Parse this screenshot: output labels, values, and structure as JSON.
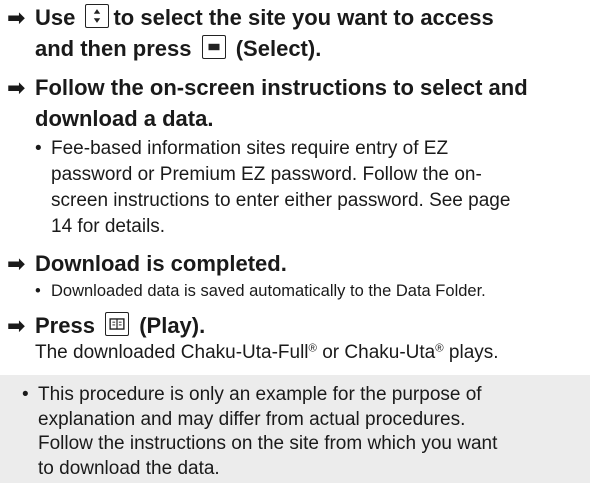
{
  "steps": [
    {
      "arrow": "➡",
      "line1_before": "Use",
      "key1_icon": "up-down-navigation-key-icon",
      "line1_after": "to select the site you want to access",
      "line2_before": "and then press",
      "key2_icon": "center-select-key-icon",
      "line2_after": "(Select)."
    },
    {
      "arrow": "➡",
      "line1": "Follow the on-screen instructions to select and",
      "line2": "download a data.",
      "bullets": [
        {
          "lines": [
            "Fee-based information sites require entry of EZ",
            "password or Premium EZ password. Follow the on-",
            "screen instructions to enter either password. See page",
            "14 for details."
          ]
        }
      ]
    },
    {
      "arrow": "➡",
      "line1": "Download is completed.",
      "bullets": [
        {
          "text": "Downloaded data is saved automatically to the Data Folder."
        }
      ]
    },
    {
      "arrow": "➡",
      "line1_before": "Press",
      "key_icon": "book-play-key-icon",
      "line1_after": "(Play).",
      "body_part1": "The downloaded Chaku-Uta-Full",
      "reg1": "®",
      "body_part2": " or Chaku-Uta",
      "reg2": "®",
      "body_part3": " plays."
    }
  ],
  "note": {
    "lines": [
      "This procedure is only an example for the purpose of",
      "explanation and may differ from actual procedures.",
      "Follow the instructions on the site from which you want",
      "to download the data."
    ]
  }
}
